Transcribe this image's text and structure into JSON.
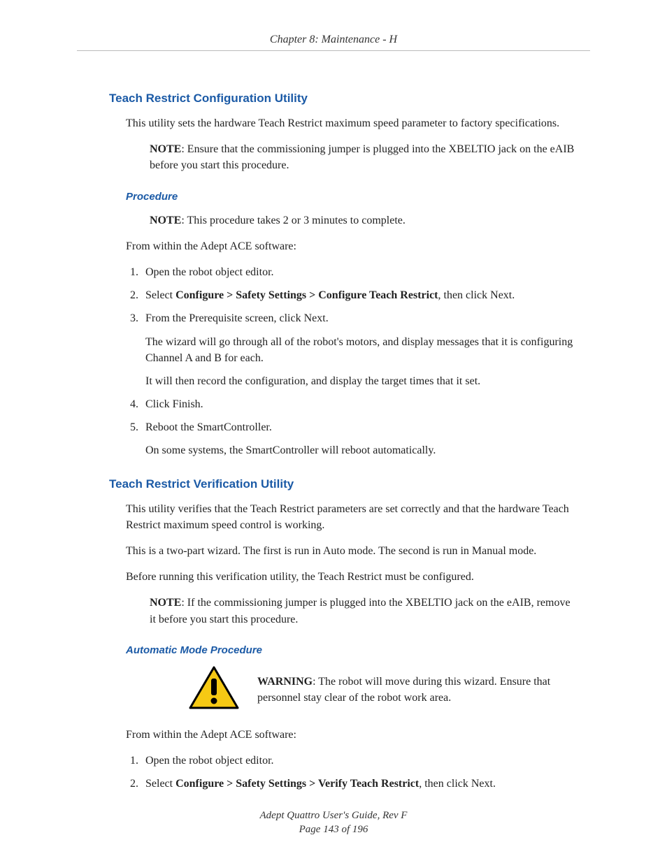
{
  "header": {
    "chapter_line": "Chapter 8: Maintenance - H"
  },
  "sections": {
    "config": {
      "title": "Teach Restrict Configuration Utility",
      "intro": "This utility sets the hardware Teach Restrict maximum speed parameter to factory specifications.",
      "note1_label": "NOTE",
      "note1_text": ": Ensure that the commissioning jumper is plugged into the XBELTIO jack on the eAIB before you start this procedure.",
      "procedure_title": "Procedure",
      "note2_label": "NOTE",
      "note2_text": ": This procedure takes 2 or 3 minutes to complete.",
      "lead_in": "From within the Adept ACE software:",
      "steps": {
        "s1": "Open the robot object editor.",
        "s2_pre": "Select ",
        "s2_bold": "Configure > Safety Settings > Configure Teach Restrict",
        "s2_post": ", then click Next.",
        "s3": "From the Prerequisite screen, click Next.",
        "s3a": "The wizard will go through all of the robot's motors, and display messages that it is configuring Channel A and B for each.",
        "s3b": "It will then record the configuration, and display the target times that it set.",
        "s4": "Click Finish.",
        "s5": "Reboot the SmartController.",
        "s5a": "On some systems, the SmartController will reboot automatically."
      }
    },
    "verify": {
      "title": "Teach Restrict Verification Utility",
      "p1": "This utility verifies that the Teach Restrict parameters are set correctly and that the hardware Teach Restrict maximum speed control is working.",
      "p2": "This is a two-part wizard. The first is run in Auto mode. The second is run in Manual mode.",
      "p3": "Before running this verification utility, the Teach Restrict must be configured.",
      "note_label": "NOTE",
      "note_text": ": If the commissioning jumper is plugged into the XBELTIO jack on the eAIB, remove it before you start this procedure.",
      "auto_title": "Automatic Mode Procedure",
      "warn_label": "WARNING",
      "warn_text": ": The robot will move during this wizard. Ensure that personnel stay clear of the robot work area.",
      "lead_in": "From within the Adept ACE software:",
      "steps": {
        "s1": "Open the robot object editor.",
        "s2_pre": "Select ",
        "s2_bold": "Configure > Safety Settings > Verify Teach Restrict",
        "s2_post": ", then click Next."
      }
    }
  },
  "footer": {
    "guide": "Adept Quattro User's Guide, Rev F",
    "page": "Page 143 of 196"
  }
}
